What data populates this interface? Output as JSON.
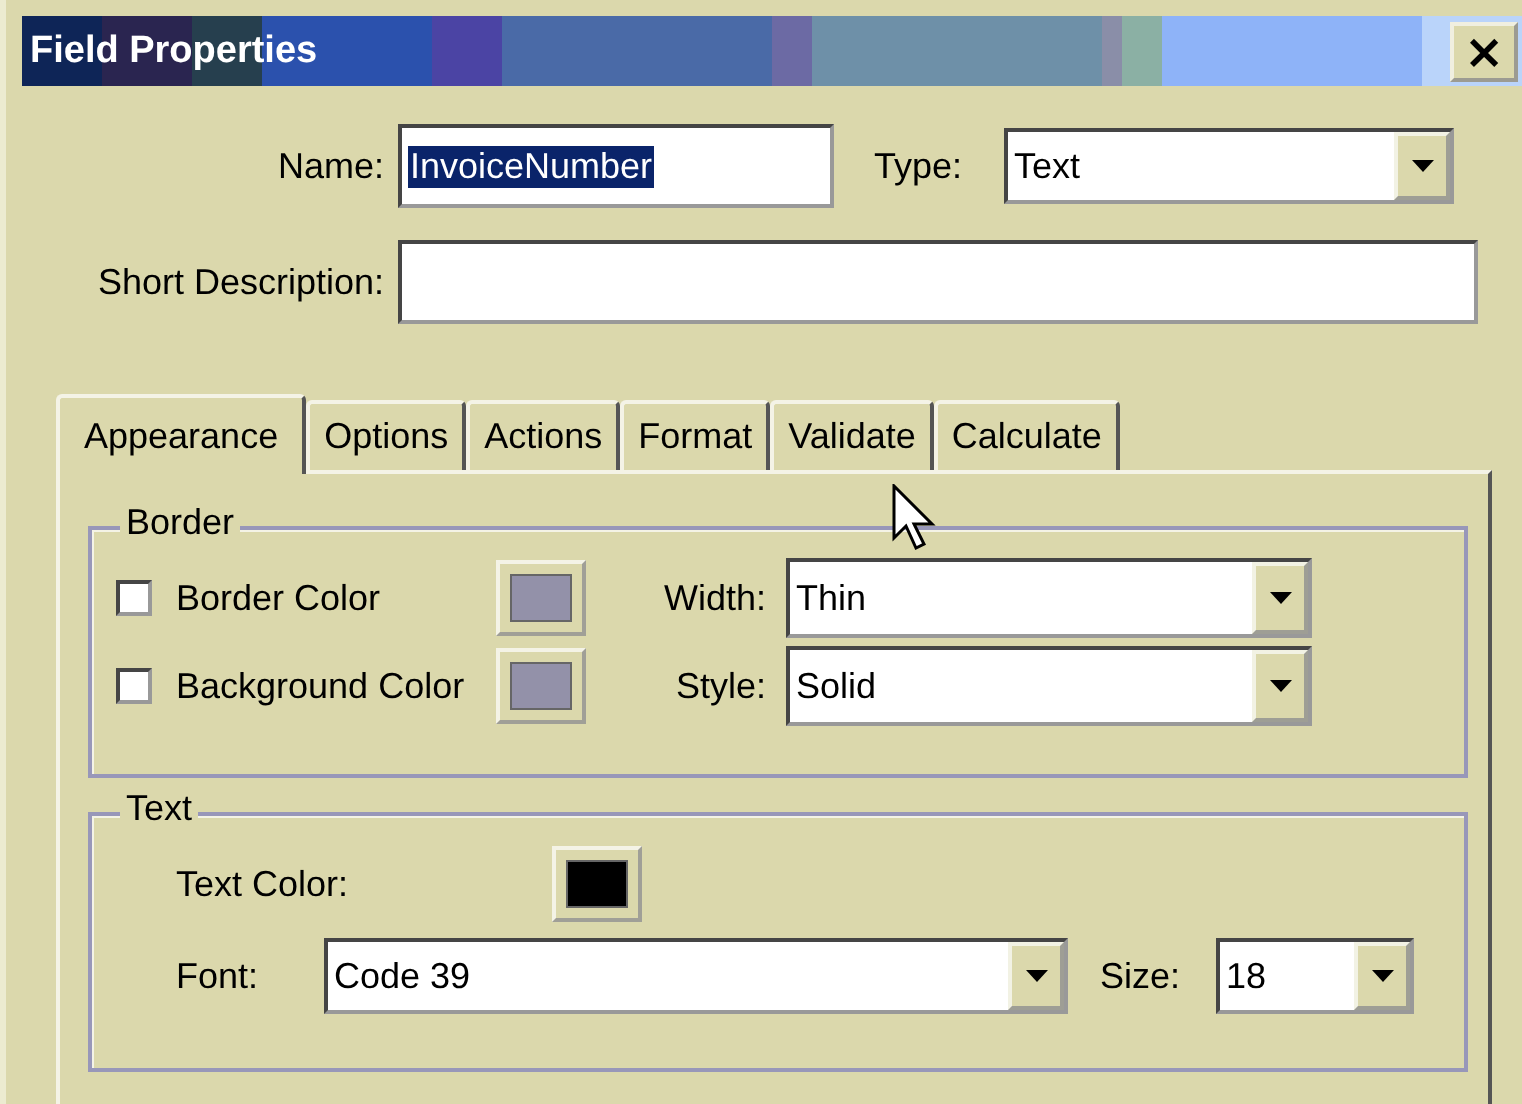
{
  "window": {
    "title": "Field Properties",
    "close": "×"
  },
  "name": {
    "label": "Name:",
    "value": "InvoiceNumber",
    "selected": true
  },
  "type": {
    "label": "Type:",
    "value": "Text"
  },
  "short_description": {
    "label": "Short Description:"
  },
  "tabs": [
    {
      "label": "Appearance",
      "selected": true
    },
    {
      "label": "Options",
      "selected": false
    },
    {
      "label": "Actions",
      "selected": false
    },
    {
      "label": "Format",
      "selected": false
    },
    {
      "label": "Validate",
      "selected": false
    },
    {
      "label": "Calculate",
      "selected": false
    }
  ],
  "border_group": {
    "title": "Border",
    "rows": [
      {
        "label": "Border Color",
        "checked": false,
        "color": "#9391a9",
        "field_label": "Width:",
        "value": "Thin"
      },
      {
        "label": "Background Color",
        "checked": false,
        "color": "#9391a9",
        "field_label": "Style:",
        "value": "Solid"
      }
    ]
  },
  "text_group": {
    "title": "Text",
    "color_label": "Text Color:",
    "color": "#000000",
    "font_label": "Font:",
    "font": "Code 39",
    "size_label": "Size:",
    "size": "18"
  }
}
